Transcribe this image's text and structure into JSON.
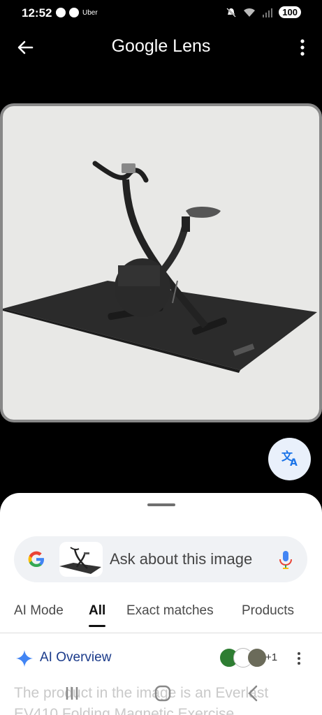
{
  "status_bar": {
    "time": "12:52",
    "uber": "Uber",
    "battery": "100"
  },
  "top_bar": {
    "title": "Google Lens"
  },
  "search": {
    "placeholder": "Ask about this image"
  },
  "tabs": [
    {
      "label": "AI Mode"
    },
    {
      "label": "All"
    },
    {
      "label": "Exact matches"
    },
    {
      "label": "Products"
    }
  ],
  "active_tab": "All",
  "ai_overview": {
    "label": "AI Overview",
    "source_count": "+1",
    "text": "The product in the image is an Everlast EV410 Folding Magnetic Exercise"
  },
  "colors": {
    "accent_blue": "#1a73e8",
    "sheet_bg": "#ffffff",
    "frame_bg": "#000000"
  }
}
